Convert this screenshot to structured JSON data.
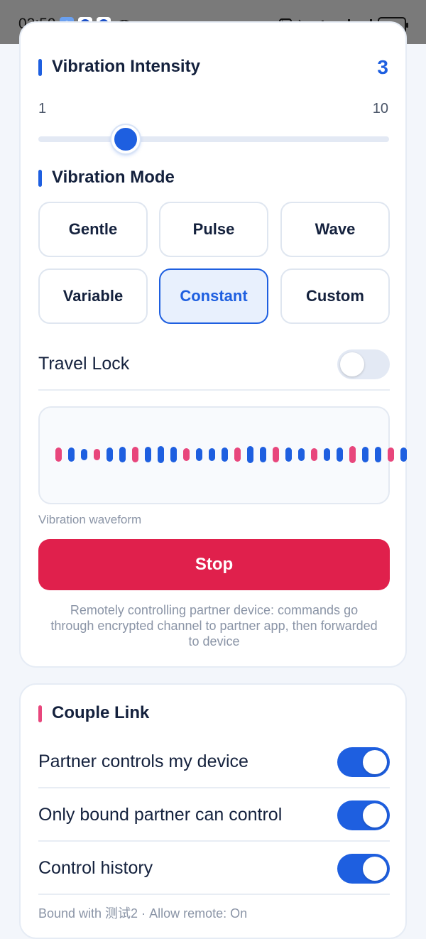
{
  "status_bar": {
    "time": "02:59",
    "app_badge": "6",
    "battery": "61",
    "icons": [
      "nfc-icon",
      "alarm-off-icon",
      "bluetooth-icon",
      "signal-icon",
      "signal-icon",
      "battery-icon"
    ]
  },
  "intensity": {
    "title": "Vibration Intensity",
    "value": "3",
    "min_label": "1",
    "max_label": "10",
    "min": 1,
    "max": 10,
    "level": 3
  },
  "mode": {
    "title": "Vibration Mode",
    "options": [
      "Gentle",
      "Pulse",
      "Wave",
      "Variable",
      "Constant",
      "Custom"
    ],
    "selected": "Constant"
  },
  "travel_lock": {
    "label": "Travel Lock",
    "on": false
  },
  "waveform": {
    "caption": "Vibration waveform",
    "bars": [
      {
        "h": 20,
        "c": "pink"
      },
      {
        "h": 20,
        "c": "blue"
      },
      {
        "h": 16,
        "c": "blue"
      },
      {
        "h": 16,
        "c": "pink"
      },
      {
        "h": 20,
        "c": "blue"
      },
      {
        "h": 22,
        "c": "blue"
      },
      {
        "h": 22,
        "c": "pink"
      },
      {
        "h": 22,
        "c": "blue"
      },
      {
        "h": 24,
        "c": "blue"
      },
      {
        "h": 22,
        "c": "blue"
      },
      {
        "h": 18,
        "c": "pink"
      },
      {
        "h": 18,
        "c": "blue"
      },
      {
        "h": 18,
        "c": "blue"
      },
      {
        "h": 20,
        "c": "blue"
      },
      {
        "h": 20,
        "c": "pink"
      },
      {
        "h": 24,
        "c": "blue"
      },
      {
        "h": 22,
        "c": "blue"
      },
      {
        "h": 22,
        "c": "pink"
      },
      {
        "h": 20,
        "c": "blue"
      },
      {
        "h": 18,
        "c": "blue"
      },
      {
        "h": 18,
        "c": "pink"
      },
      {
        "h": 18,
        "c": "blue"
      },
      {
        "h": 20,
        "c": "blue"
      },
      {
        "h": 24,
        "c": "pink"
      },
      {
        "h": 22,
        "c": "blue"
      },
      {
        "h": 22,
        "c": "blue"
      },
      {
        "h": 20,
        "c": "pink"
      },
      {
        "h": 20,
        "c": "blue"
      }
    ],
    "colors": {
      "blue": "#1e5fe0",
      "pink": "#e8467c"
    }
  },
  "stop_button": {
    "label": "Stop"
  },
  "footnote": "Remotely controlling partner device: commands go through encrypted channel to partner app, then forwarded to device",
  "couple_link": {
    "title": "Couple Link",
    "rows": [
      {
        "label": "Partner controls my device",
        "on": true
      },
      {
        "label": "Only bound partner can control",
        "on": true
      },
      {
        "label": "Control history",
        "on": true
      }
    ],
    "bound_info": "Bound with 测试2 · Allow remote: On"
  },
  "colors": {
    "accent": "#1e5fe0",
    "danger": "#e0204c",
    "pink": "#e8467c",
    "text": "#14213d",
    "muted": "#8a94a6"
  }
}
